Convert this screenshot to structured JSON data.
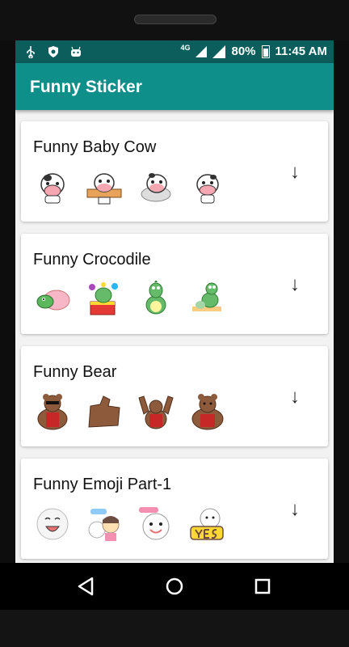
{
  "status_bar": {
    "network": "4G",
    "battery_percent": "80%",
    "time": "11:45 AM"
  },
  "app_bar": {
    "title": "Funny Sticker"
  },
  "packs": [
    {
      "title": "Funny Baby Cow",
      "stickers": [
        "cow-sticker",
        "cow-sticker",
        "cow-sticker",
        "cow-sticker"
      ]
    },
    {
      "title": "Funny Crocodile",
      "stickers": [
        "crocodile-sticker",
        "crocodile-sticker",
        "crocodile-sticker",
        "crocodile-sticker"
      ]
    },
    {
      "title": "Funny Bear",
      "stickers": [
        "bear-sticker",
        "bear-sticker",
        "bear-sticker",
        "bear-sticker"
      ]
    },
    {
      "title": "Funny Emoji Part-1",
      "stickers": [
        "emoji-sticker",
        "emoji-sticker",
        "emoji-sticker",
        "emoji-sticker"
      ]
    }
  ],
  "download_icon": "↓",
  "colors": {
    "app_bar": "#0e8f89",
    "status_bar": "#0b5e5c"
  }
}
